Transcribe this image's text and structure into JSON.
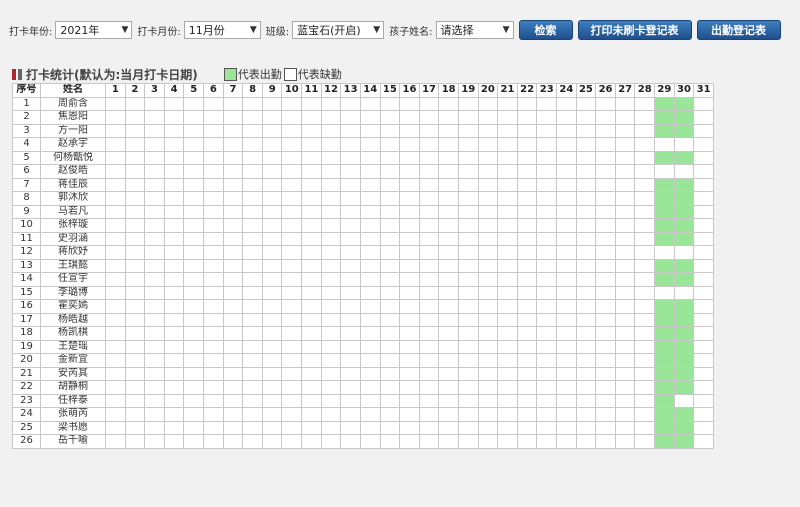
{
  "filters": {
    "year_label": "打卡年份:",
    "year_value": "2021年",
    "month_label": "打卡月份:",
    "month_value": "11月份",
    "class_label": "班级:",
    "class_value": "蓝宝石(开启)",
    "child_label": "孩子姓名:",
    "child_value": "请选择"
  },
  "buttons": {
    "search": "检索",
    "print_unclocked": "打印未刷卡登记表",
    "attendance_sheet": "出勤登记表"
  },
  "section": {
    "title": "打卡统计(默认为:当月打卡日期)",
    "legend_present": "代表出勤",
    "legend_absent": "代表缺勤"
  },
  "colors": {
    "present": "#99e699",
    "absent": "#ffffff",
    "button": "#2a5f9e"
  },
  "table": {
    "col_index": "序号",
    "col_name": "姓名",
    "days": [
      "1",
      "2",
      "3",
      "4",
      "5",
      "6",
      "7",
      "8",
      "9",
      "10",
      "11",
      "12",
      "13",
      "14",
      "15",
      "16",
      "17",
      "18",
      "19",
      "20",
      "21",
      "22",
      "23",
      "24",
      "25",
      "26",
      "27",
      "28",
      "29",
      "30",
      "31"
    ],
    "rows": [
      {
        "no": "1",
        "name": "周俞含",
        "present": [
          29,
          30
        ]
      },
      {
        "no": "2",
        "name": "焦恩阳",
        "present": [
          29,
          30
        ]
      },
      {
        "no": "3",
        "name": "方一阳",
        "present": [
          29,
          30
        ]
      },
      {
        "no": "4",
        "name": "赵承宇",
        "present": []
      },
      {
        "no": "5",
        "name": "何杨甑悦",
        "present": [
          29,
          30
        ]
      },
      {
        "no": "6",
        "name": "赵俊皓",
        "present": []
      },
      {
        "no": "7",
        "name": "蒋佳辰",
        "present": [
          29,
          30
        ]
      },
      {
        "no": "8",
        "name": "郭沐欣",
        "present": [
          29,
          30
        ]
      },
      {
        "no": "9",
        "name": "马若凡",
        "present": [
          29,
          30
        ]
      },
      {
        "no": "10",
        "name": "张梓璇",
        "present": [
          29,
          30
        ]
      },
      {
        "no": "11",
        "name": "史羽涵",
        "present": [
          29,
          30
        ]
      },
      {
        "no": "12",
        "name": "蒋欣妤",
        "present": []
      },
      {
        "no": "13",
        "name": "王琪懿",
        "present": [
          29,
          30
        ]
      },
      {
        "no": "14",
        "name": "任宣宇",
        "present": [
          29,
          30
        ]
      },
      {
        "no": "15",
        "name": "李璐博",
        "present": []
      },
      {
        "no": "16",
        "name": "霍奕嫣",
        "present": [
          29,
          30
        ]
      },
      {
        "no": "17",
        "name": "杨皓越",
        "present": [
          29,
          30
        ]
      },
      {
        "no": "18",
        "name": "杨凯棋",
        "present": [
          29,
          30
        ]
      },
      {
        "no": "19",
        "name": "王楚瑶",
        "present": [
          29,
          30
        ]
      },
      {
        "no": "20",
        "name": "金新宜",
        "present": [
          29,
          30
        ]
      },
      {
        "no": "21",
        "name": "安芮其",
        "present": [
          29,
          30
        ]
      },
      {
        "no": "22",
        "name": "胡静桐",
        "present": [
          29,
          30
        ]
      },
      {
        "no": "23",
        "name": "任梓泰",
        "present": [
          29
        ]
      },
      {
        "no": "24",
        "name": "张萌芮",
        "present": [
          29,
          30
        ]
      },
      {
        "no": "25",
        "name": "梁书愿",
        "present": [
          29,
          30
        ]
      },
      {
        "no": "26",
        "name": "岳千喻",
        "present": [
          29,
          30
        ]
      }
    ]
  }
}
